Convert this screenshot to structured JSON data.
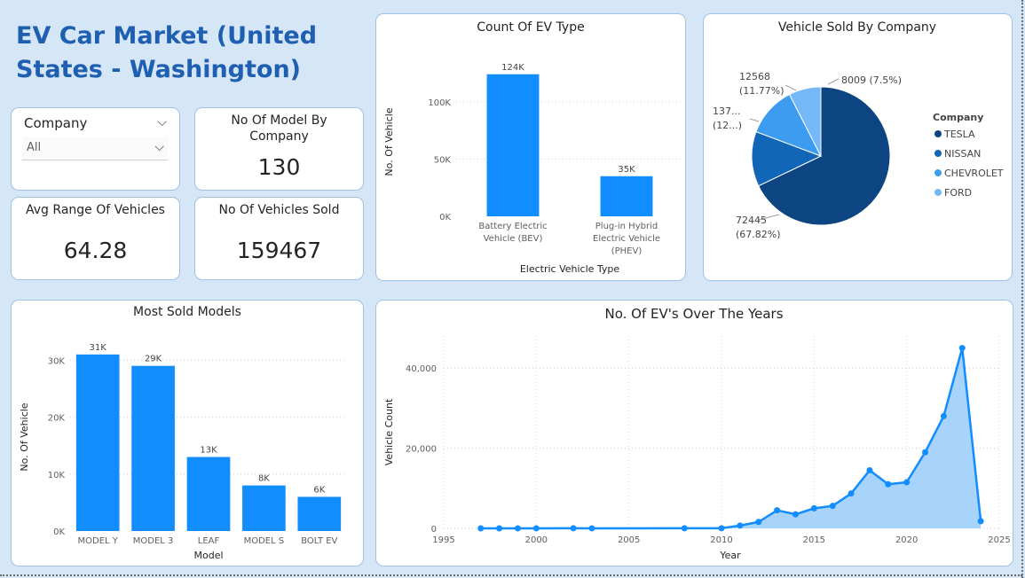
{
  "dashboard": {
    "title": "EV Car Market (United States - Washington)"
  },
  "slicer": {
    "label": "Company",
    "value": "All",
    "chevron_icon": "chevron-down-icon"
  },
  "kpis": {
    "models": {
      "label": "No Of Model By Company",
      "value": "130"
    },
    "avg_range": {
      "label": "Avg Range Of Vehicles",
      "value": "64.28"
    },
    "sold": {
      "label": "No Of Vehicles Sold",
      "value": "159467"
    }
  },
  "colors": {
    "bar": "#118dff",
    "area_line": "#118dff",
    "area_fill": "#a8d3fb",
    "tesla": "#0c4582",
    "nissan": "#1266b8",
    "chevrolet": "#3d9cf0",
    "ford": "#74b8f7",
    "title_blue": "#1f5fb1"
  },
  "chart_data": [
    {
      "id": "ev_type",
      "type": "bar",
      "title": "Count Of EV Type",
      "xlabel": "Electric Vehicle Type",
      "ylabel": "No. Of Vehicle",
      "categories": [
        "Battery Electric Vehicle (BEV)",
        "Plug-in Hybrid Electric Vehicle (PHEV)"
      ],
      "category_lines": [
        [
          "Battery Electric",
          "Vehicle (BEV)"
        ],
        [
          "Plug-in Hybrid",
          "Electric Vehicle",
          "(PHEV)"
        ]
      ],
      "values": [
        124000,
        35000
      ],
      "data_labels": [
        "124K",
        "35K"
      ],
      "yticks": [
        0,
        50000,
        100000
      ],
      "ytick_labels": [
        "0K",
        "50K",
        "100K"
      ],
      "ylim": [
        0,
        130000
      ],
      "grid": true
    },
    {
      "id": "company_pie",
      "type": "pie",
      "title": "Vehicle Sold By Company",
      "legend_title": "Company",
      "legend_position": "right",
      "labels": [
        "TESLA",
        "NISSAN",
        "CHEVROLET",
        "FORD"
      ],
      "values": [
        72445,
        13700,
        12568,
        8009
      ],
      "data_labels": [
        [
          "72445",
          "(67.82%)"
        ],
        [
          "137...",
          "(12...)"
        ],
        [
          "12568",
          "(11.77%)"
        ],
        [
          "8009 (7.5%)"
        ]
      ]
    },
    {
      "id": "models",
      "type": "bar",
      "title": "Most Sold Models",
      "xlabel": "Model",
      "ylabel": "No. Of Vehicle",
      "categories": [
        "MODEL Y",
        "MODEL 3",
        "LEAF",
        "MODEL S",
        "BOLT EV"
      ],
      "values": [
        31000,
        29000,
        13000,
        8000,
        6000
      ],
      "data_labels": [
        "31K",
        "29K",
        "13K",
        "8K",
        "6K"
      ],
      "yticks": [
        0,
        10000,
        20000,
        30000
      ],
      "ytick_labels": [
        "0K",
        "10K",
        "20K",
        "30K"
      ],
      "ylim": [
        0,
        33000
      ],
      "grid": true
    },
    {
      "id": "years",
      "type": "area",
      "title": "No. Of EV's Over The Years",
      "xlabel": "Year",
      "ylabel": "Vehicle Count",
      "x": [
        1997,
        1998,
        1999,
        2000,
        2002,
        2003,
        2008,
        2010,
        2011,
        2012,
        2013,
        2014,
        2015,
        2016,
        2017,
        2018,
        2019,
        2020,
        2021,
        2022,
        2023,
        2024
      ],
      "y": [
        2,
        4,
        5,
        10,
        20,
        10,
        20,
        25,
        700,
        1600,
        4500,
        3500,
        5000,
        5600,
        8700,
        14500,
        11000,
        11500,
        19000,
        28000,
        45000,
        1800
      ],
      "xticks": [
        1995,
        2000,
        2005,
        2010,
        2015,
        2020,
        2025
      ],
      "yticks": [
        0,
        20000,
        40000
      ],
      "ytick_labels": [
        "0",
        "20,000",
        "40,000"
      ],
      "xlim": [
        1995,
        2025
      ],
      "ylim": [
        0,
        48000
      ],
      "grid": true
    }
  ]
}
